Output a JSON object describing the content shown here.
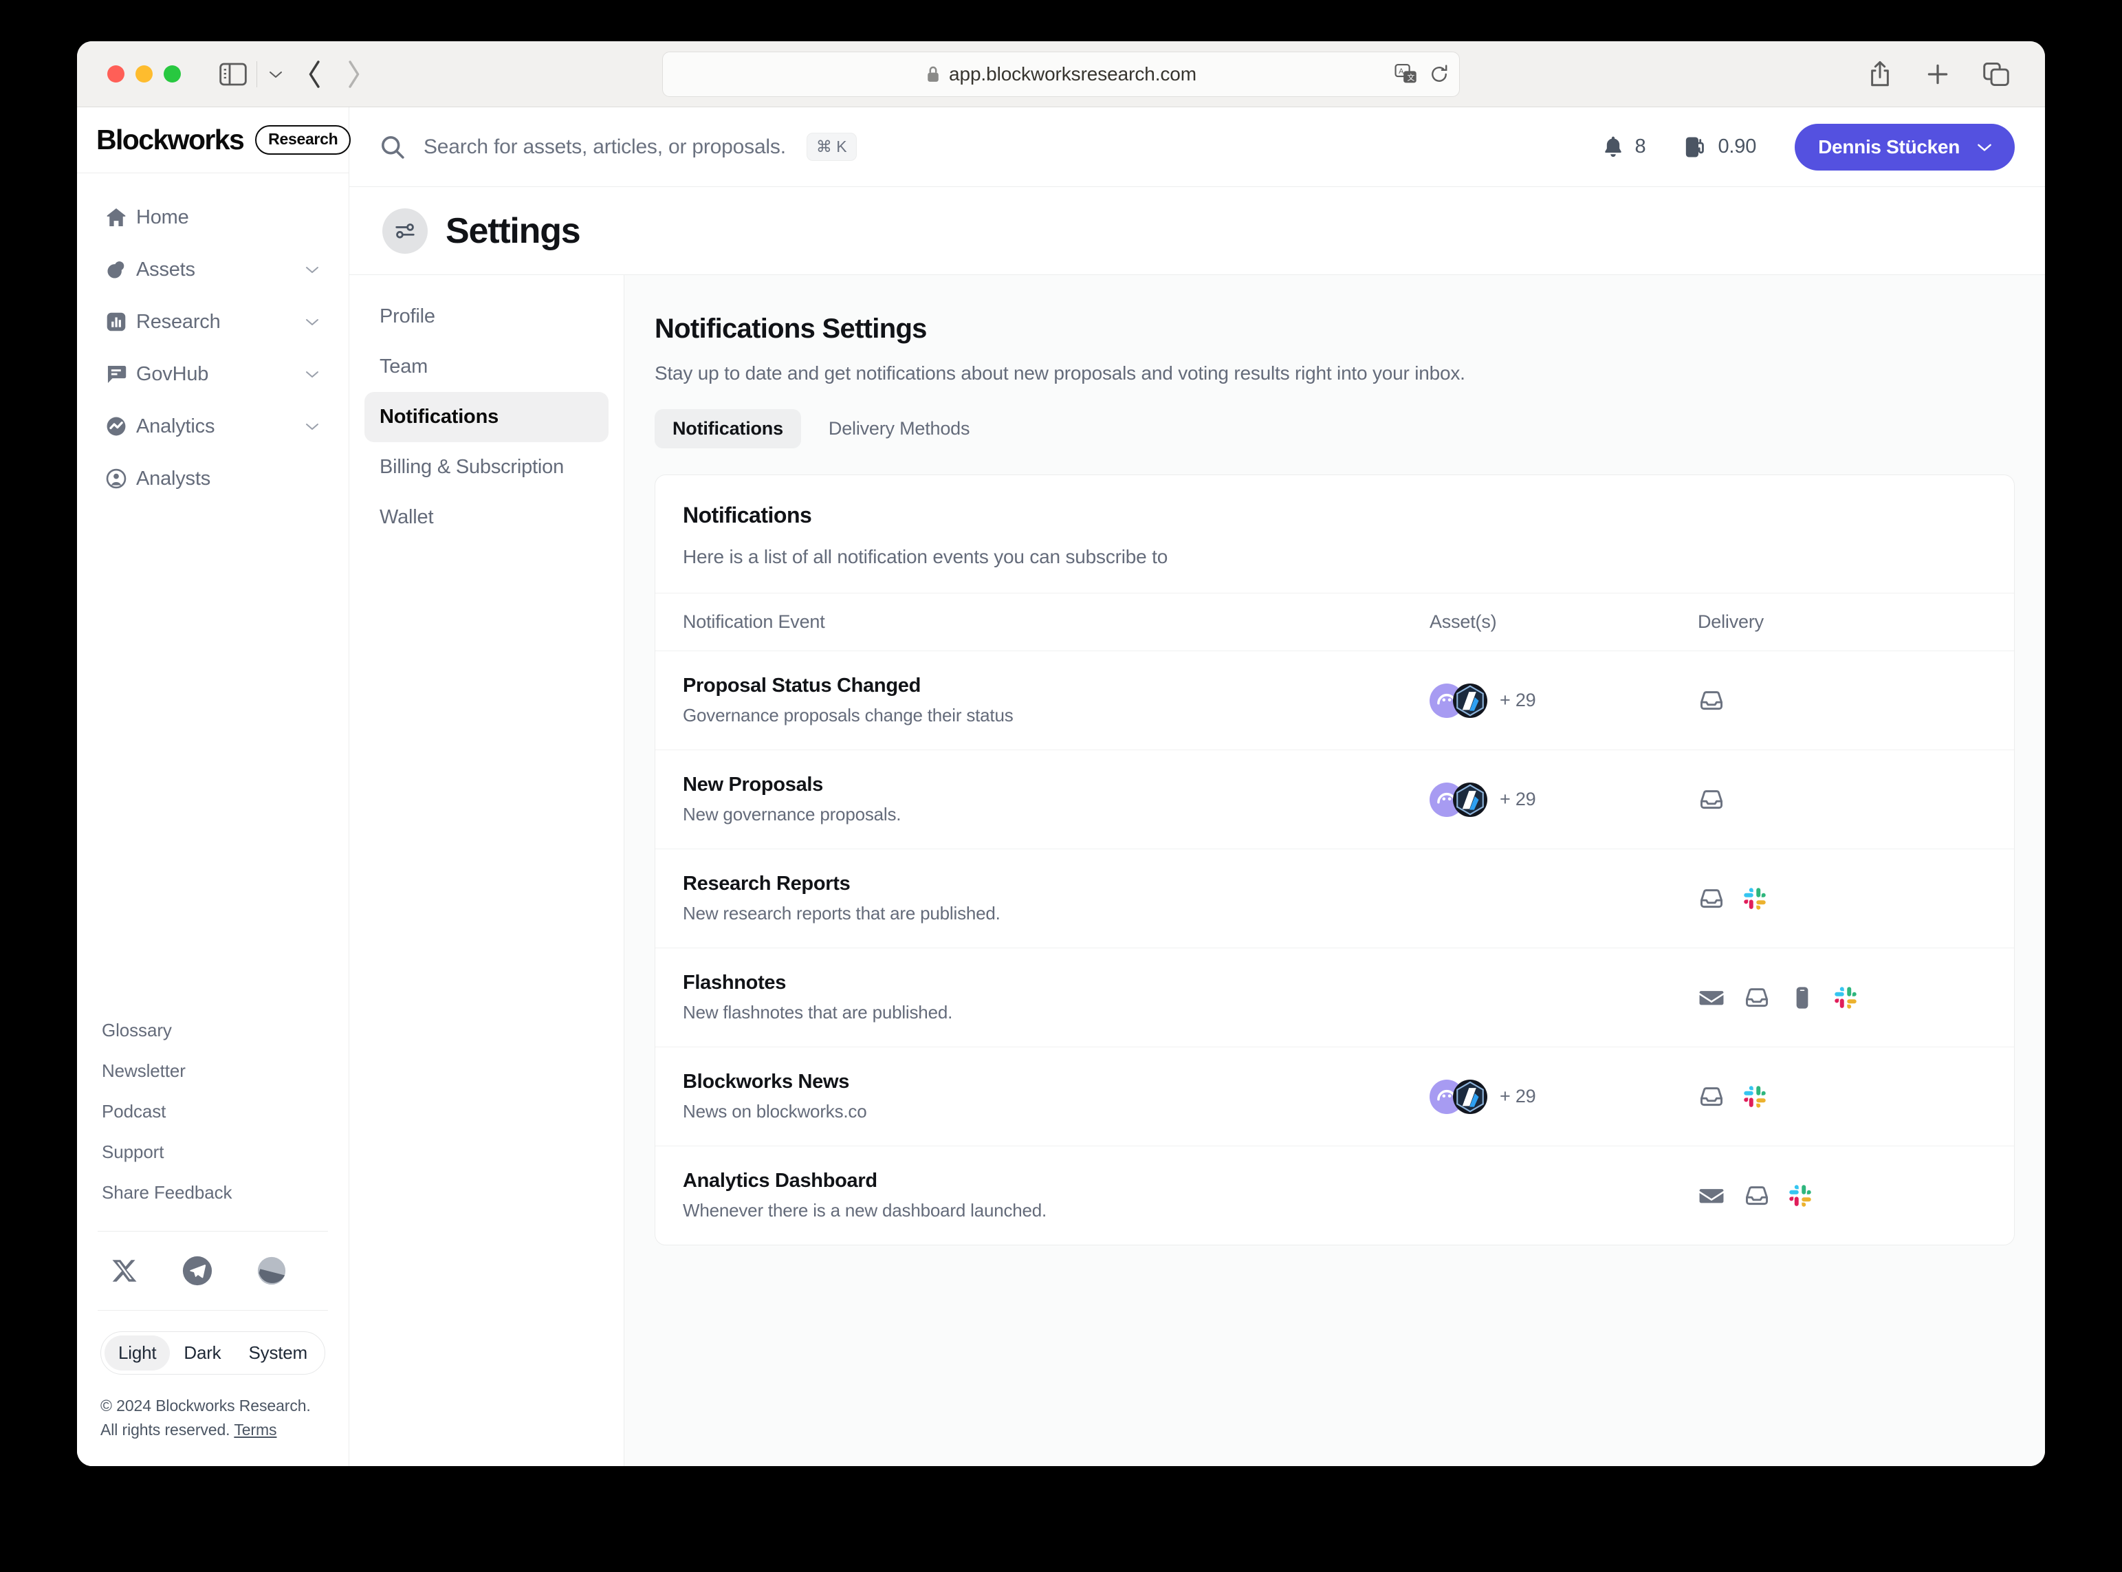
{
  "browser": {
    "url": "app.blockworksresearch.com",
    "lock_icon": "lock-icon",
    "sidebar_toggle_icon": "sidebar-toggle-icon",
    "back_icon": "chevron-left-icon",
    "forward_icon": "chevron-right-icon",
    "translate_icon": "translate-icon",
    "reload_icon": "reload-icon",
    "share_icon": "share-icon",
    "new_tab_icon": "plus-icon",
    "tabs_icon": "tab-overview-icon"
  },
  "sidebar": {
    "brand": {
      "word": "Blockworks",
      "pill": "Research"
    },
    "items": [
      {
        "label": "Home",
        "icon": "home-icon",
        "expandable": false
      },
      {
        "label": "Assets",
        "icon": "assets-icon",
        "expandable": true
      },
      {
        "label": "Research",
        "icon": "research-icon",
        "expandable": true
      },
      {
        "label": "GovHub",
        "icon": "govhub-icon",
        "expandable": true
      },
      {
        "label": "Analytics",
        "icon": "analytics-icon",
        "expandable": true
      },
      {
        "label": "Analysts",
        "icon": "analysts-icon",
        "expandable": false
      }
    ],
    "links": [
      "Glossary",
      "Newsletter",
      "Podcast",
      "Support",
      "Share Feedback"
    ],
    "socials": [
      "x-icon",
      "telegram-icon",
      "mirror-icon"
    ],
    "theme": {
      "options": [
        "Light",
        "Dark",
        "System"
      ],
      "selected": "Light"
    },
    "copyright_line1": "© 2024 Blockworks Research.",
    "copyright_line2_prefix": "All rights reserved. ",
    "copyright_terms": "Terms"
  },
  "header": {
    "search_placeholder": "Search for assets, articles, or proposals.",
    "search_shortcut": "⌘ K",
    "search_icon": "search-icon",
    "notifications_icon": "bell-icon",
    "notifications_count": "8",
    "gas_icon": "gas-pump-icon",
    "gas_value": "0.90",
    "user_name": "Dennis Stücken",
    "user_caret_icon": "chevron-down-icon",
    "accent_color": "#5451e0"
  },
  "page": {
    "title": "Settings",
    "title_icon": "sliders-icon"
  },
  "settings_nav": {
    "items": [
      "Profile",
      "Team",
      "Notifications",
      "Billing & Subscription",
      "Wallet"
    ],
    "active": "Notifications"
  },
  "notifications": {
    "heading": "Notifications Settings",
    "subheading": "Stay up to date and get notifications about new proposals and voting results right into your inbox.",
    "tabs": [
      {
        "label": "Notifications",
        "active": true
      },
      {
        "label": "Delivery Methods",
        "active": false
      }
    ],
    "card": {
      "title": "Notifications",
      "description": "Here is a list of all notification events you can subscribe to",
      "columns": [
        "Notification Event",
        "Asset(s)",
        "Delivery"
      ],
      "rows": [
        {
          "title": "Proposal Status Changed",
          "description": "Governance proposals change their status",
          "assets": {
            "avatars": [
              "avatar-lavender-icon",
              "avatar-arbitrum-icon"
            ],
            "overflow": "+ 29"
          },
          "delivery": [
            "inbox-icon"
          ]
        },
        {
          "title": "New Proposals",
          "description": "New governance proposals.",
          "assets": {
            "avatars": [
              "avatar-lavender-icon",
              "avatar-arbitrum-icon"
            ],
            "overflow": "+ 29"
          },
          "delivery": [
            "inbox-icon"
          ]
        },
        {
          "title": "Research Reports",
          "description": "New research reports that are published.",
          "assets": {
            "avatars": [],
            "overflow": ""
          },
          "delivery": [
            "inbox-icon",
            "slack-icon"
          ]
        },
        {
          "title": "Flashnotes",
          "description": "New flashnotes that are published.",
          "assets": {
            "avatars": [],
            "overflow": ""
          },
          "delivery": [
            "email-icon",
            "inbox-icon",
            "mobile-icon",
            "slack-icon"
          ]
        },
        {
          "title": "Blockworks News",
          "description": "News on blockworks.co",
          "assets": {
            "avatars": [
              "avatar-lavender-icon",
              "avatar-arbitrum-icon"
            ],
            "overflow": "+ 29"
          },
          "delivery": [
            "inbox-icon",
            "slack-icon"
          ]
        },
        {
          "title": "Analytics Dashboard",
          "description": "Whenever there is a new dashboard launched.",
          "assets": {
            "avatars": [],
            "overflow": ""
          },
          "delivery": [
            "email-icon",
            "inbox-icon",
            "slack-icon"
          ]
        }
      ]
    }
  }
}
